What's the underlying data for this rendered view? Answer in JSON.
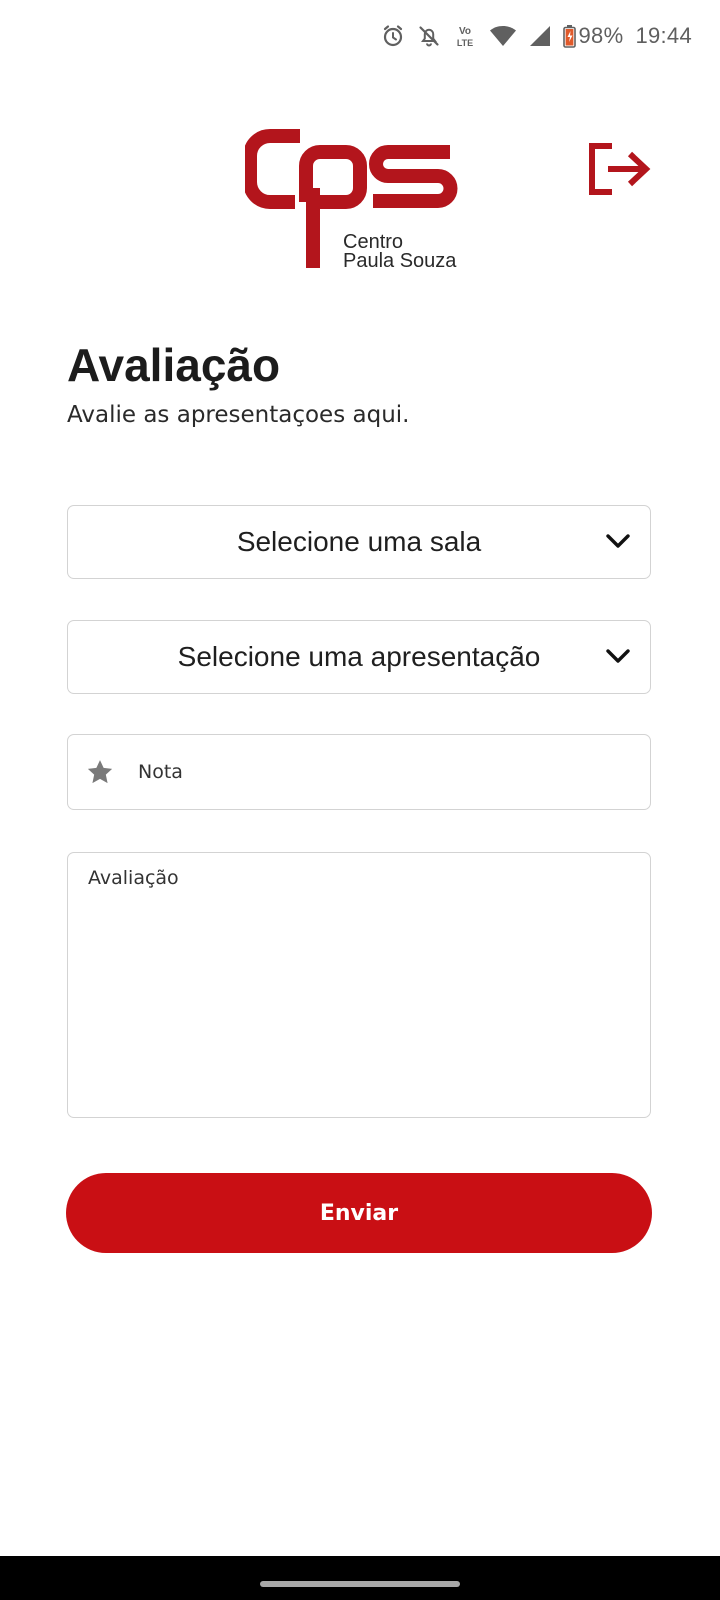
{
  "status_bar": {
    "battery": "98%",
    "time": "19:44",
    "icons": [
      "alarm-icon",
      "bell-off-icon",
      "volte-icon",
      "wifi-icon",
      "signal-icon",
      "battery-icon"
    ],
    "volte_top": "Vo",
    "volte_bottom": "LTE"
  },
  "header": {
    "logo_line1": "Centro",
    "logo_line2": "Paula Souza",
    "logout_icon": "logout-icon"
  },
  "page": {
    "title": "Avaliação",
    "subtitle": "Avalie as apresentaçoes aqui."
  },
  "form": {
    "room_select": "Selecione uma sala",
    "presentation_select": "Selecione uma apresentação",
    "grade_placeholder": "Nota",
    "review_placeholder": "Avaliação",
    "submit_label": "Enviar"
  },
  "colors": {
    "brand_red": "#c90f14",
    "logo_red": "#b3151c"
  }
}
